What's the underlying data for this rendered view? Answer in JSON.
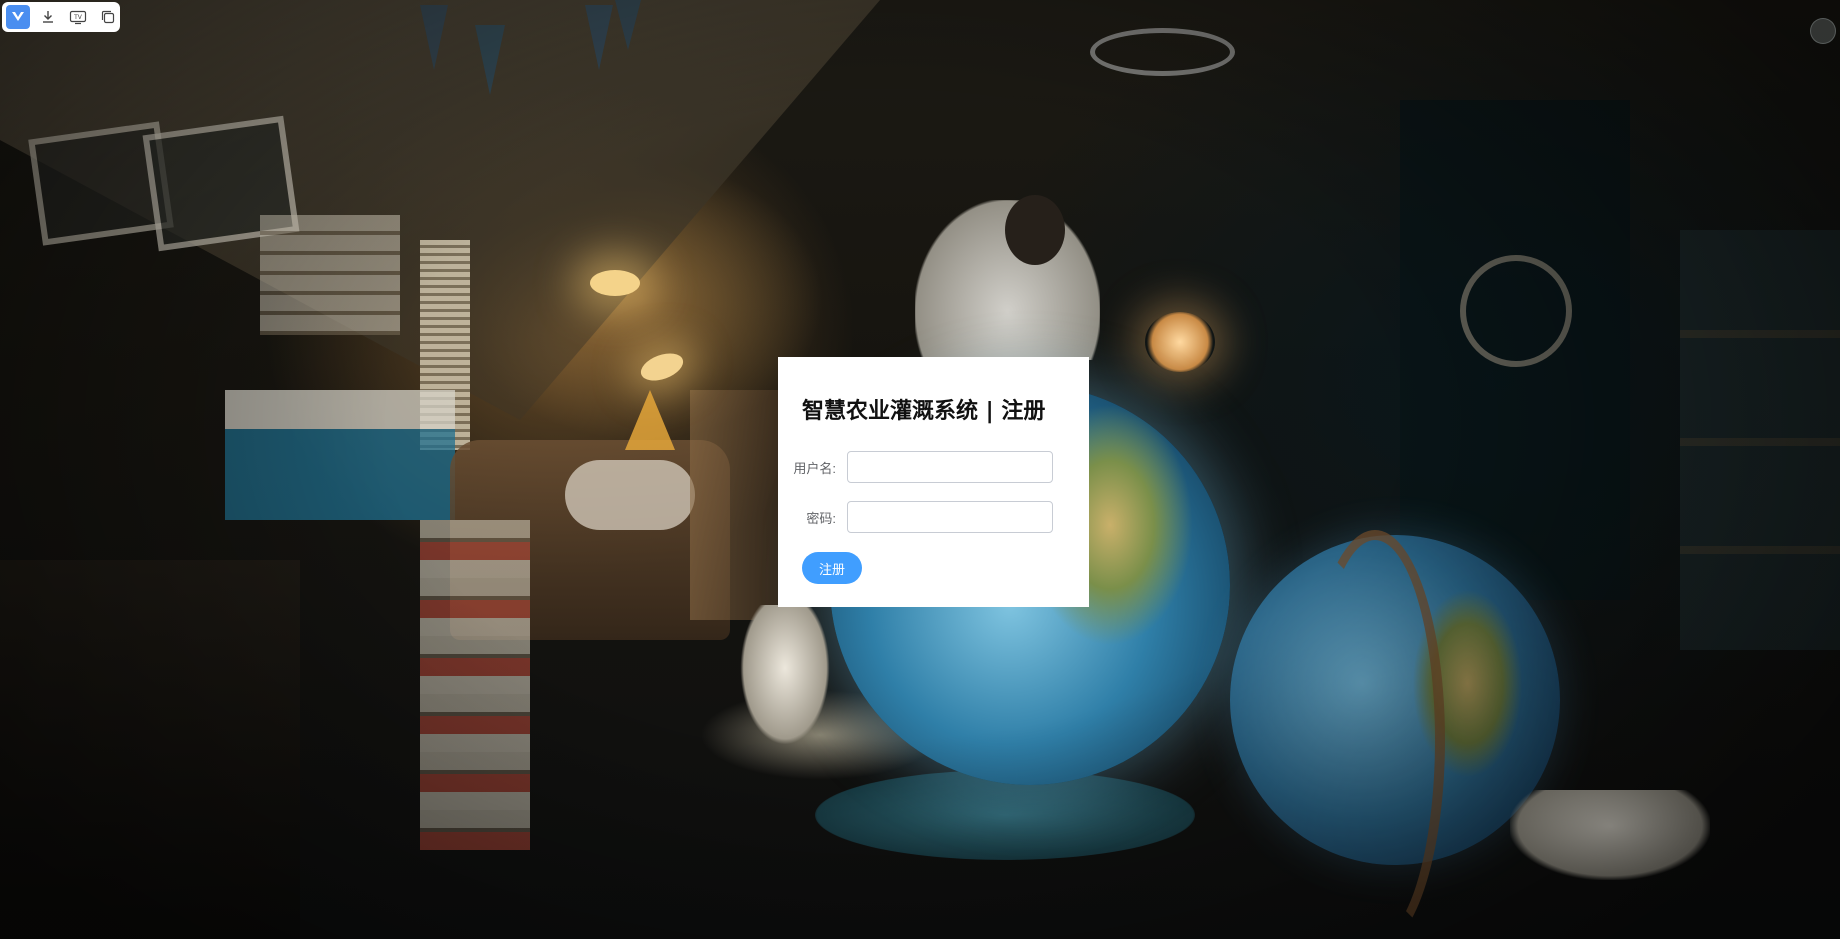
{
  "toolbar": {
    "icons": [
      "app-logo-icon",
      "download-icon",
      "tv-icon",
      "copy-icon"
    ],
    "tv_label": "TV"
  },
  "register": {
    "title": "智慧农业灌溉系统 | 注册",
    "username_label": "用户名:",
    "username_value": "",
    "password_label": "密码:",
    "password_value": "",
    "submit_label": "注册"
  },
  "colors": {
    "primary": "#409eff",
    "card_bg": "#ffffff",
    "title": "#111111",
    "label": "#606266"
  }
}
